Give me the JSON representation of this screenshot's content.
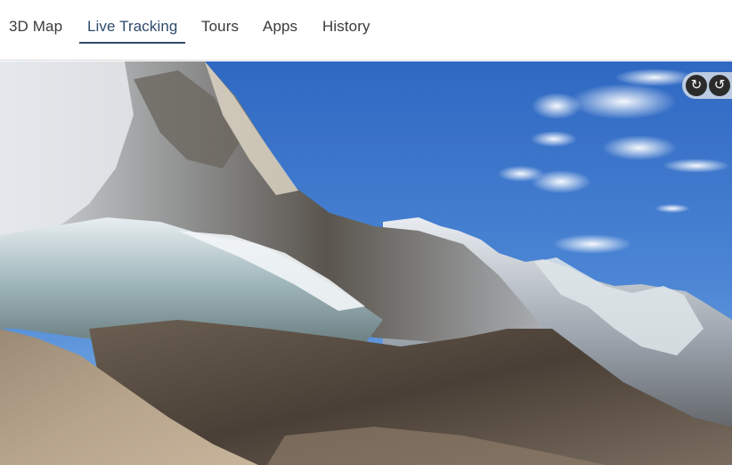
{
  "nav": {
    "tabs": [
      {
        "label": "3D Map",
        "active": false
      },
      {
        "label": "Live Tracking",
        "active": true
      },
      {
        "label": "Tours",
        "active": false
      },
      {
        "label": "Apps",
        "active": false
      },
      {
        "label": "History",
        "active": false
      }
    ],
    "accent_color": "#2f4a6b"
  },
  "map": {
    "controls": [
      {
        "icon": "rotate-left-icon",
        "glyph": "↻"
      },
      {
        "icon": "rotate-right-icon",
        "glyph": "↺"
      }
    ]
  }
}
